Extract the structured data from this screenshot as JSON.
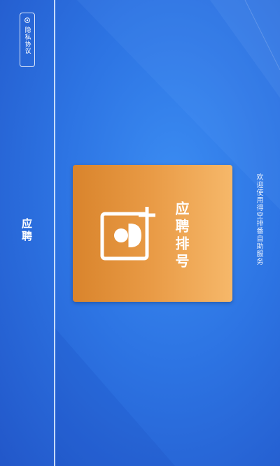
{
  "sidebar": {
    "privacy": {
      "label": "隐私协议",
      "icon": "gear-icon"
    },
    "nav_item_label": "应聘"
  },
  "main": {
    "card": {
      "label": "应聘排号",
      "icon": "add-person-icon",
      "colors": [
        "#d9842c",
        "#f6b86a"
      ]
    },
    "welcome_text": "欢迎使用得空排番自助服务"
  },
  "theme": {
    "background": "#2d74e3",
    "accent": "#e99b46"
  }
}
